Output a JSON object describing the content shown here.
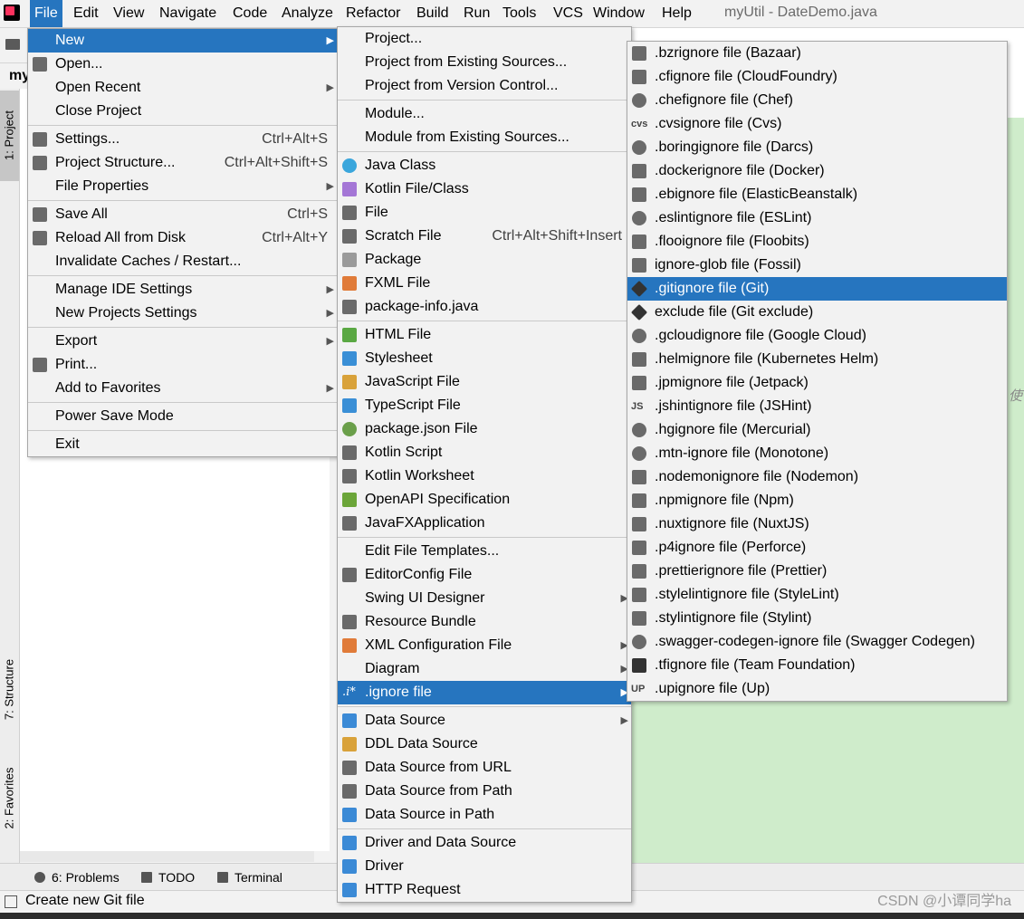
{
  "window": {
    "title": "myUtil - DateDemo.java"
  },
  "menubar": [
    "File",
    "Edit",
    "View",
    "Navigate",
    "Code",
    "Analyze",
    "Refactor",
    "Build",
    "Run",
    "Tools",
    "VCS",
    "Window",
    "Help"
  ],
  "project": {
    "header": "my"
  },
  "side_tabs": {
    "project": "1: Project",
    "structure": "7: Structure",
    "favorites": "2: Favorites"
  },
  "editor": {
    "hint_char": "使"
  },
  "file_menu": [
    {
      "label": "New",
      "sub": true,
      "sel": true
    },
    {
      "label": "Open...",
      "icon": "folder-icon"
    },
    {
      "label": "Open Recent",
      "sub": true
    },
    {
      "label": "Close Project",
      "sep_after": true
    },
    {
      "label": "Settings...",
      "shortcut": "Ctrl+Alt+S",
      "icon": "wrench-icon"
    },
    {
      "label": "Project Structure...",
      "shortcut": "Ctrl+Alt+Shift+S",
      "icon": "project-structure-icon"
    },
    {
      "label": "File Properties",
      "sub": true,
      "sep_after": true
    },
    {
      "label": "Save All",
      "shortcut": "Ctrl+S",
      "icon": "save-icon"
    },
    {
      "label": "Reload All from Disk",
      "shortcut": "Ctrl+Alt+Y",
      "icon": "reload-icon"
    },
    {
      "label": "Invalidate Caches / Restart...",
      "sep_after": true
    },
    {
      "label": "Manage IDE Settings",
      "sub": true
    },
    {
      "label": "New Projects Settings",
      "sub": true,
      "sep_after": true
    },
    {
      "label": "Export",
      "sub": true
    },
    {
      "label": "Print...",
      "icon": "printer-icon"
    },
    {
      "label": "Add to Favorites",
      "sub": true,
      "sep_after": true
    },
    {
      "label": "Power Save Mode",
      "sep_after": true
    },
    {
      "label": "Exit"
    }
  ],
  "new_menu": [
    {
      "label": "Project..."
    },
    {
      "label": "Project from Existing Sources..."
    },
    {
      "label": "Project from Version Control...",
      "sep_after": true
    },
    {
      "label": "Module..."
    },
    {
      "label": "Module from Existing Sources...",
      "sep_after": true
    },
    {
      "label": "Java Class",
      "icon": "java-class-icon"
    },
    {
      "label": "Kotlin File/Class",
      "icon": "kotlin-file-icon"
    },
    {
      "label": "File",
      "icon": "file-icon"
    },
    {
      "label": "Scratch File",
      "shortcut": "Ctrl+Alt+Shift+Insert",
      "icon": "scratch-file-icon"
    },
    {
      "label": "Package",
      "icon": "package-icon"
    },
    {
      "label": "FXML File",
      "icon": "fxml-file-icon"
    },
    {
      "label": "package-info.java",
      "icon": "java-file-icon",
      "sep_after": true
    },
    {
      "label": "HTML File",
      "icon": "html-file-icon"
    },
    {
      "label": "Stylesheet",
      "icon": "css-file-icon"
    },
    {
      "label": "JavaScript File",
      "icon": "js-file-icon"
    },
    {
      "label": "TypeScript File",
      "icon": "ts-file-icon"
    },
    {
      "label": "package.json File",
      "icon": "nodejs-icon"
    },
    {
      "label": "Kotlin Script",
      "icon": "kotlin-script-icon"
    },
    {
      "label": "Kotlin Worksheet",
      "icon": "kotlin-worksheet-icon"
    },
    {
      "label": "OpenAPI Specification",
      "icon": "openapi-icon"
    },
    {
      "label": "JavaFXApplication",
      "icon": "javafx-icon",
      "sep_after": true
    },
    {
      "label": "Edit File Templates..."
    },
    {
      "label": "EditorConfig File",
      "icon": "gear-icon"
    },
    {
      "label": "Swing UI Designer",
      "sub": true
    },
    {
      "label": "Resource Bundle",
      "icon": "resource-bundle-icon"
    },
    {
      "label": "XML Configuration File",
      "sub": true,
      "icon": "xml-file-icon"
    },
    {
      "label": "Diagram",
      "sub": true
    },
    {
      "label": ".ignore file",
      "sub": true,
      "sel": true,
      "icon": "ignore-file-icon",
      "sep_after": true
    },
    {
      "label": "Data Source",
      "sub": true,
      "icon": "database-icon"
    },
    {
      "label": "DDL Data Source",
      "icon": "ddl-icon"
    },
    {
      "label": "Data Source from URL",
      "icon": "url-source-icon"
    },
    {
      "label": "Data Source from Path",
      "icon": "folder-icon"
    },
    {
      "label": "Data Source in Path",
      "icon": "database-icon",
      "sep_after": true
    },
    {
      "label": "Driver and Data Source",
      "icon": "driver-icon"
    },
    {
      "label": "Driver",
      "icon": "driver-icon"
    },
    {
      "label": "HTTP Request",
      "icon": "api-icon"
    }
  ],
  "ignore_menu": [
    {
      "label": ".bzrignore file (Bazaar)",
      "icon": "bazaar-icon"
    },
    {
      "label": ".cfignore file (CloudFoundry)",
      "icon": "cloudfoundry-icon"
    },
    {
      "label": ".chefignore file (Chef)",
      "icon": "chef-icon"
    },
    {
      "label": ".cvsignore file (Cvs)",
      "icon": "cvs-icon",
      "icon_text": "cvs"
    },
    {
      "label": ".boringignore file (Darcs)",
      "icon": "darcs-icon"
    },
    {
      "label": ".dockerignore file (Docker)",
      "icon": "docker-icon"
    },
    {
      "label": ".ebignore file (ElasticBeanstalk)",
      "icon": "elasticbeanstalk-icon"
    },
    {
      "label": ".eslintignore file (ESLint)",
      "icon": "eslint-icon"
    },
    {
      "label": ".flooignore file (Floobits)",
      "icon": "floobits-icon"
    },
    {
      "label": "ignore-glob file (Fossil)",
      "icon": "fossil-icon"
    },
    {
      "label": ".gitignore file (Git)",
      "icon": "git-icon",
      "sel": true
    },
    {
      "label": "exclude file (Git exclude)",
      "icon": "git-icon"
    },
    {
      "label": ".gcloudignore file (Google Cloud)",
      "icon": "gcloud-icon"
    },
    {
      "label": ".helmignore file (Kubernetes Helm)",
      "icon": "helm-icon"
    },
    {
      "label": ".jpmignore file (Jetpack)",
      "icon": "jetpack-icon"
    },
    {
      "label": ".jshintignore file (JSHint)",
      "icon": "jshint-icon",
      "icon_text": "JS"
    },
    {
      "label": ".hgignore file (Mercurial)",
      "icon": "mercurial-icon"
    },
    {
      "label": ".mtn-ignore file (Monotone)",
      "icon": "monotone-icon"
    },
    {
      "label": ".nodemonignore file (Nodemon)",
      "icon": "nodemon-icon"
    },
    {
      "label": ".npmignore file (Npm)",
      "icon": "npm-icon"
    },
    {
      "label": ".nuxtignore file (NuxtJS)",
      "icon": "nuxt-icon"
    },
    {
      "label": ".p4ignore file (Perforce)",
      "icon": "perforce-icon"
    },
    {
      "label": ".prettierignore file (Prettier)",
      "icon": "prettier-icon"
    },
    {
      "label": ".stylelintignore file (StyleLint)",
      "icon": "stylelint-icon"
    },
    {
      "label": ".stylintignore file (Stylint)",
      "icon": "stylint-icon"
    },
    {
      "label": ".swagger-codegen-ignore file (Swagger Codegen)",
      "icon": "swagger-icon"
    },
    {
      "label": ".tfignore file (Team Foundation)",
      "icon": "tfs-icon"
    },
    {
      "label": ".upignore file (Up)",
      "icon": "up-icon",
      "icon_text": "UP"
    }
  ],
  "bottom_tabs": [
    {
      "label": "6: Problems",
      "icon": "problems-icon"
    },
    {
      "label": "TODO",
      "icon": "todo-icon"
    },
    {
      "label": "Terminal",
      "icon": "terminal-icon"
    }
  ],
  "status": {
    "text": "Create new Git file",
    "watermark": "CSDN @小谭同学ha"
  },
  "colors": {
    "accent": "#2675bf",
    "editor_bg": "#cfeccb",
    "menu_bg": "#f2f2f2"
  }
}
